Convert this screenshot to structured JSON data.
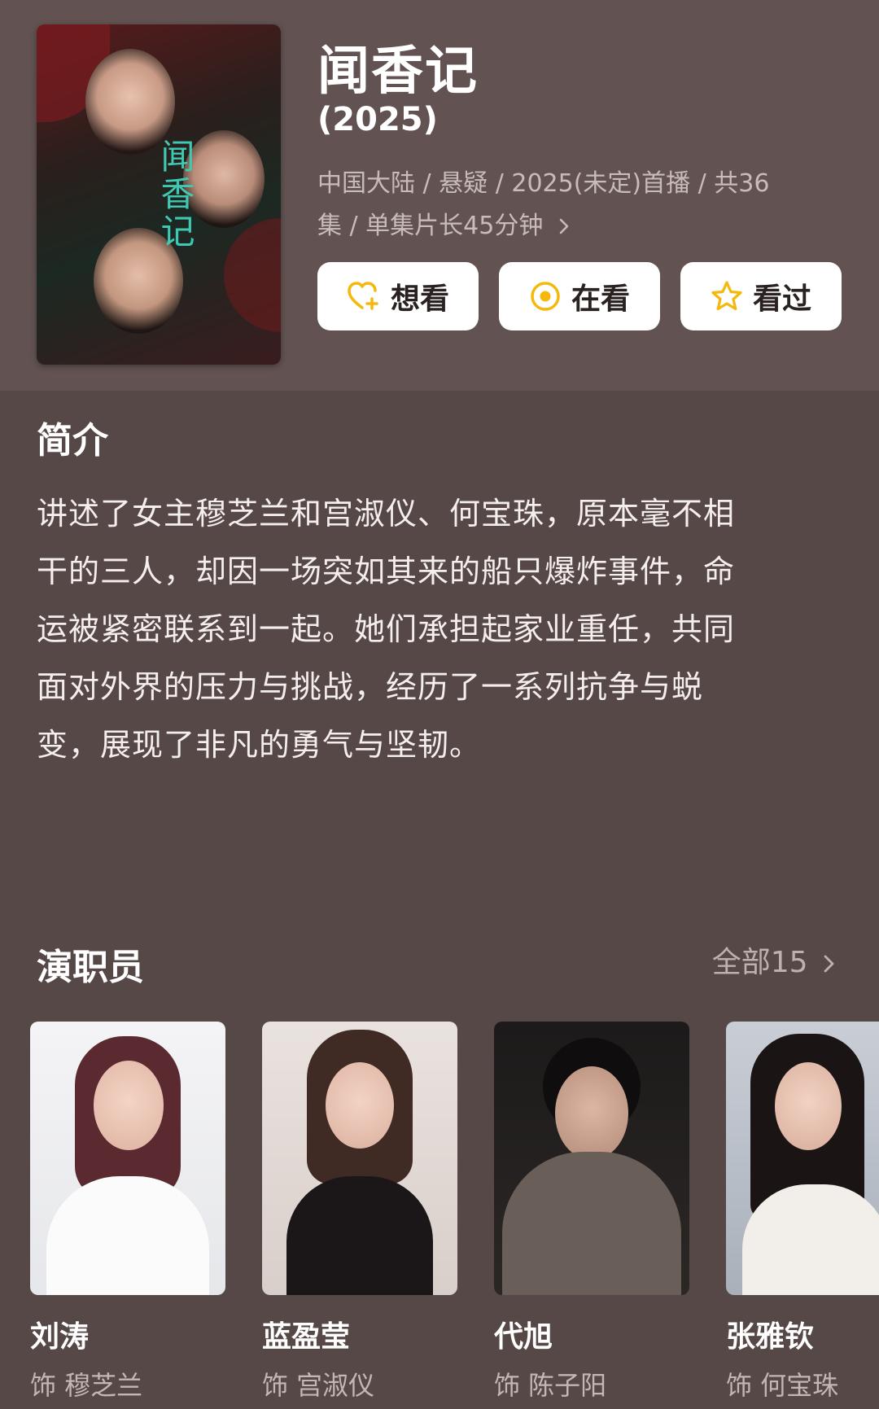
{
  "show": {
    "title": "闻香记",
    "year": "(2025)",
    "meta_line1": "中国大陆 / 悬疑 / 2025(未定)首播 / 共36",
    "meta_line2": "集 / 单集片长45分钟",
    "poster_title": "闻香记"
  },
  "actions": [
    {
      "label": "想看",
      "icon": "heart-plus-icon"
    },
    {
      "label": "在看",
      "icon": "target-icon"
    },
    {
      "label": "看过",
      "icon": "star-icon"
    }
  ],
  "intro": {
    "title": "简介",
    "lines": [
      "讲述了女主穆芝兰和宫淑仪、何宝珠，原本毫不相",
      "干的三人，却因一场突如其来的船只爆炸事件，命",
      "运被紧密联系到一起。她们承担起家业重任，共同",
      "面对外界的压力与挑战，经历了一系列抗争与蜕",
      "变，展现了非凡的勇气与坚韧。"
    ]
  },
  "cast": {
    "title": "演职员",
    "all_label": "全部15",
    "members": [
      {
        "name": "刘涛",
        "role": "饰 穆芝兰"
      },
      {
        "name": "蓝盈莹",
        "role": "饰 宫淑仪"
      },
      {
        "name": "代旭",
        "role": "饰 陈子阳"
      },
      {
        "name": "张雅钦",
        "role": "饰 何宝珠"
      }
    ]
  },
  "colors": {
    "background": "#564846",
    "header_bg": "#625352",
    "accent_yellow": "#f5b80c"
  }
}
